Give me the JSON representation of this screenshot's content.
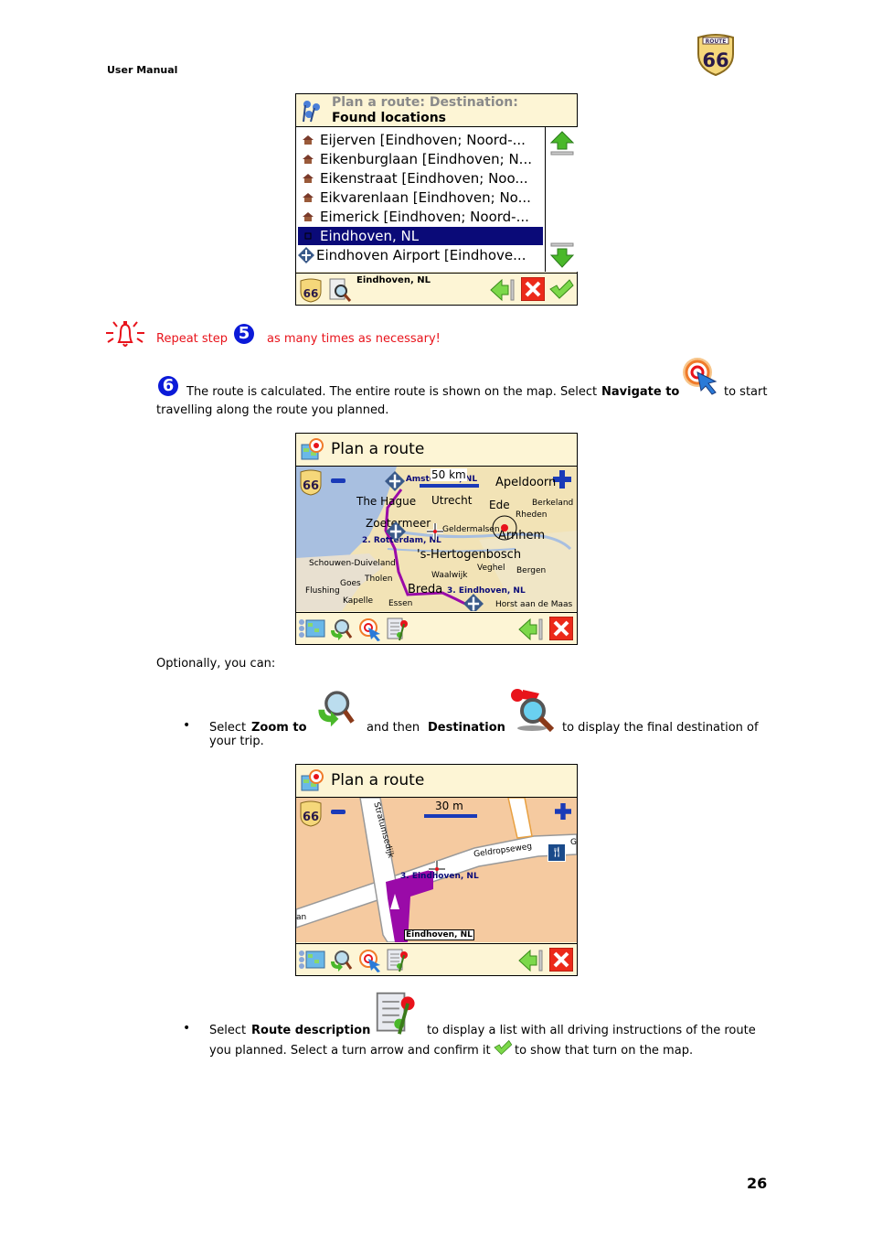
{
  "header": {
    "title": "User Manual",
    "logo_top": "ROUTE",
    "logo_number": "66"
  },
  "page_number": "26",
  "screen1": {
    "title_gray": "Plan a route: Destination:",
    "title_black": "Found locations",
    "items": [
      {
        "icon": "house-icon",
        "label": "Eijerven [Eindhoven; Noord-..."
      },
      {
        "icon": "house-icon",
        "label": "Eikenburglaan [Eindhoven; N..."
      },
      {
        "icon": "house-icon",
        "label": "Eikenstraat [Eindhoven; Noo..."
      },
      {
        "icon": "house-icon",
        "label": "Eikvarenlaan [Eindhoven; No..."
      },
      {
        "icon": "house-icon",
        "label": "Eimerick [Eindhoven; Noord-..."
      },
      {
        "icon": "city-icon",
        "label": "Eindhoven, NL",
        "selected": true
      },
      {
        "icon": "airport-icon",
        "label": "Eindhoven Airport [Eindhove..."
      }
    ],
    "selected_value": "Eindhoven, NL"
  },
  "note": {
    "prefix": "Repeat step",
    "step": "5",
    "suffix": "as many times as necessary!"
  },
  "step6": {
    "number": "6",
    "text1": "The route is calculated. The entire route is shown on the map. Select",
    "bold": "Navigate to",
    "text2": "to start",
    "text3": "travelling along the route you planned."
  },
  "screen2": {
    "title": "Plan a route",
    "scale": "50 km",
    "labels": {
      "route1": "1. Amsterdam, NL",
      "apeldoorn": "Apeldoorn",
      "thehague": "The Hague",
      "utrecht": "Utrecht",
      "ede": "Ede",
      "berkeland": "Berkeland",
      "rheden": "Rheden",
      "zoetermeer": "Zoetermeer",
      "geldermalsen": "Geldermalsen",
      "arnhem": "Arnhem",
      "route2": "2. Rotterdam, NL",
      "hertogenbosch": "'s-Hertogenbosch",
      "schouwen": "Schouwen-Duiveland",
      "veghel": "Veghel",
      "bergen": "Bergen",
      "waalwijk": "Waalwijk",
      "tholen": "Tholen",
      "goes": "Goes",
      "flushing": "Flushing",
      "breda": "Breda",
      "route3": "3. Eindhoven, NL",
      "kapelle": "Kapelle",
      "essen": "Essen",
      "horst": "Horst aan de Maas"
    }
  },
  "optional": {
    "intro": "Optionally, you can:"
  },
  "bullet1": {
    "t1": "Select",
    "b1": "Zoom to",
    "t2": "and then",
    "b2": "Destination",
    "t3": "to display the final destination of",
    "t4": "your trip."
  },
  "screen3": {
    "title": "Plan a route",
    "scale": "30 m",
    "labels": {
      "street1": "Stratumsedijk",
      "street2": "Geldropseweg",
      "route3": "3. Eindhoven, NL",
      "tooltip": "Eindhoven, NL",
      "edge_g": "G",
      "edge_n": "an"
    }
  },
  "bullet2": {
    "t1": "Select",
    "b1": "Route description",
    "t2": "to display a list with all driving instructions of the route",
    "t3": "you planned. Select a turn arrow and confirm it",
    "t4": "to show that turn on the map."
  },
  "colors": {
    "accent_red": "#e8131b",
    "step_blue": "#0b1ad8",
    "selection": "#0a0a78",
    "panel": "#fdf5d5",
    "route_purple": "#9a0aa8"
  }
}
